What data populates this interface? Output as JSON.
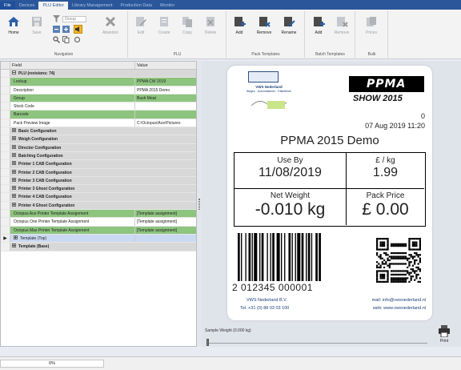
{
  "menu": {
    "file": "File",
    "tabs": [
      "Devices",
      "PLU Editor",
      "Library Management",
      "Production Data",
      "Monitor"
    ],
    "active_index": 1
  },
  "ribbon": {
    "navigation": {
      "label": "Navigation",
      "home": "Home",
      "save": "Save",
      "group": "Group",
      "abandon": "Abandon"
    },
    "plu": {
      "label": "PLU",
      "edit": "Edit",
      "create": "Create",
      "copy": "Copy",
      "delete": "Delete"
    },
    "pack_templates": {
      "label": "Pack Templates",
      "add": "Add",
      "remove": "Remove",
      "rename": "Rename"
    },
    "batch_templates": {
      "label": "Batch Templates",
      "add": "Add",
      "remove": "Remove"
    },
    "bulk": {
      "label": "Bulk",
      "prices": "Prices"
    }
  },
  "grid": {
    "col_field": "Field",
    "col_value": "Value",
    "rows": [
      {
        "type": "section",
        "exp": "minus",
        "field": "PLU (revisions: 74)",
        "value": ""
      },
      {
        "type": "green",
        "field": "Lookup",
        "value": "PPMA CW 2019"
      },
      {
        "type": "white",
        "field": "Description",
        "value": "PPMA 2015 Demo"
      },
      {
        "type": "green",
        "field": "Group",
        "value": "Bush Meat"
      },
      {
        "type": "white",
        "field": "Stock Code",
        "value": ""
      },
      {
        "type": "green",
        "field": "Barcode",
        "value": ""
      },
      {
        "type": "white",
        "field": "Pack Preview Image",
        "value": "C:\\Octopus\\Ace\\Pictures"
      },
      {
        "type": "section",
        "exp": "plus",
        "field": "Basic Configuration",
        "value": ""
      },
      {
        "type": "section",
        "exp": "plus",
        "field": "Weigh Configuration",
        "value": ""
      },
      {
        "type": "section",
        "exp": "plus",
        "field": "Director Configuration",
        "value": ""
      },
      {
        "type": "section",
        "exp": "plus",
        "field": "Batching Configuration",
        "value": ""
      },
      {
        "type": "section",
        "exp": "plus",
        "field": "Printer 1 CAB Configuration",
        "value": ""
      },
      {
        "type": "section",
        "exp": "plus",
        "field": "Printer 2 CAB Configuration",
        "value": ""
      },
      {
        "type": "section",
        "exp": "plus",
        "field": "Printer 3 CAB Configuration",
        "value": ""
      },
      {
        "type": "section",
        "exp": "plus",
        "field": "Printer 3 Ghost Configuration",
        "value": ""
      },
      {
        "type": "section",
        "exp": "plus",
        "field": "Printer 4 CAB Configuration",
        "value": ""
      },
      {
        "type": "section",
        "exp": "plus",
        "field": "Printer 4 Ghost Configuration",
        "value": ""
      },
      {
        "type": "green",
        "field": "Octopus Ace Printer Template Assignment",
        "value": "[Template assignment]"
      },
      {
        "type": "white",
        "field": "Octopus One Printer Template Assignment",
        "value": "[Template assignment]"
      },
      {
        "type": "green",
        "field": "Octopus Max Printer Template Assignment",
        "value": "[Template assignment]"
      },
      {
        "type": "selected",
        "exp": "plus",
        "arrow": "▶",
        "field": "Template (Top)",
        "value": ""
      },
      {
        "type": "section",
        "exp": "plus",
        "field": "Template (Base)",
        "value": ""
      }
    ]
  },
  "label": {
    "company_name": "VWS Nederland",
    "company_tagline": "Wagen · Automatiseren · Etiketteren",
    "ppma_logo": "PPMA",
    "show_text": "SHOW 2015",
    "pack_count": "0",
    "datetime": "07 Aug 2019 11:20",
    "title": "PPMA 2015 Demo",
    "use_by_label": "Use By",
    "use_by_value": "11/08/2019",
    "price_per_kg_label": "£ / kg",
    "price_per_kg_value": "1.99",
    "net_weight_label": "Net Weight",
    "net_weight_value": "-0.010 kg",
    "pack_price_label": "Pack Price",
    "pack_price_value": "£ 0.00",
    "barcode_text": "2 012345 000001",
    "footer_company": "VWS Nederland B.V.",
    "footer_phone": "Tel. +31 (0) 88 03 03 100",
    "footer_mail": "mail: info@vwsnederland.nl",
    "footer_web": "web: www.vwsnederland.nl"
  },
  "sample": {
    "label": "Sample Weight (0.000 kg)",
    "print_label": "Print"
  },
  "status": {
    "progress": "0%"
  },
  "colors": {
    "menubar": "#2b579a",
    "green_row": "#8dc47e",
    "selected_row": "#cad9f2",
    "section_row": "#d8d8d8"
  }
}
